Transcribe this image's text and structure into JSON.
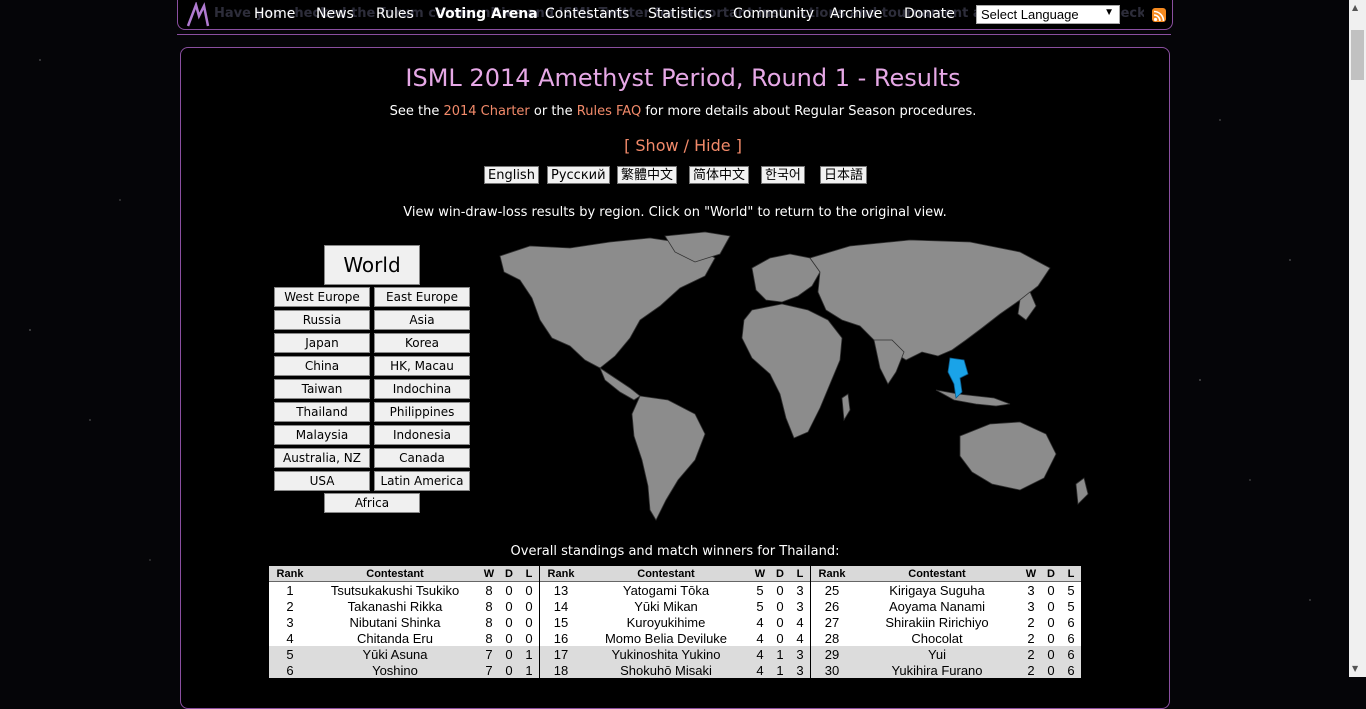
{
  "nav": {
    "ghost_text": "Have you checked the forum communities and ISML Twitter for important instructions and tournament announcements? Check out the upcoming events and other fun activities.",
    "items": [
      "Home",
      "News",
      "Rules",
      "Voting Arena",
      "Contestants",
      "Statistics",
      "Community",
      "Archive",
      "Donate"
    ],
    "language_select": "Select Language"
  },
  "page": {
    "title": "ISML 2014 Amethyst Period, Round 1 - Results",
    "subtitle_pre": "See the ",
    "subtitle_link1": "2014 Charter",
    "subtitle_mid": " or the ",
    "subtitle_link2": "Rules FAQ",
    "subtitle_post": " for more details about Regular Season procedures.",
    "show_hide": "[ Show / Hide ]",
    "languages": [
      "English",
      "Русский",
      "繁體中文",
      "简体中文",
      "한국어",
      "日本語"
    ],
    "instructions": "View win-draw-loss results by region. Click on \"World\" to return to the original view.",
    "standings_caption": "Overall standings and match winners for Thailand:"
  },
  "regions": {
    "world": "World",
    "buttons": [
      "West Europe",
      "East Europe",
      "Russia",
      "Asia",
      "Japan",
      "Korea",
      "China",
      "HK, Macau",
      "Taiwan",
      "Indochina",
      "Thailand",
      "Philippines",
      "Malaysia",
      "Indonesia",
      "Australia, NZ",
      "Canada",
      "USA",
      "Latin America",
      "Africa"
    ]
  },
  "table": {
    "headers": [
      "Rank",
      "Contestant",
      "W",
      "D",
      "L"
    ],
    "columns": [
      [
        [
          "1",
          "Tsutsukakushi Tsukiko",
          "8",
          "0",
          "0"
        ],
        [
          "2",
          "Takanashi Rikka",
          "8",
          "0",
          "0"
        ],
        [
          "3",
          "Nibutani Shinka",
          "8",
          "0",
          "0"
        ],
        [
          "4",
          "Chitanda Eru",
          "8",
          "0",
          "0"
        ],
        [
          "5",
          "Yūki Asuna",
          "7",
          "0",
          "1"
        ],
        [
          "6",
          "Yoshino",
          "7",
          "0",
          "1"
        ]
      ],
      [
        [
          "13",
          "Yatogami Tōka",
          "5",
          "0",
          "3"
        ],
        [
          "14",
          "Yūki Mikan",
          "5",
          "0",
          "3"
        ],
        [
          "15",
          "Kuroyukihime",
          "4",
          "0",
          "4"
        ],
        [
          "16",
          "Momo Belia Deviluke",
          "4",
          "0",
          "4"
        ],
        [
          "17",
          "Yukinoshita Yukino",
          "4",
          "1",
          "3"
        ],
        [
          "18",
          "Shokuhō Misaki",
          "4",
          "1",
          "3"
        ]
      ],
      [
        [
          "25",
          "Kirigaya Suguha",
          "3",
          "0",
          "5"
        ],
        [
          "26",
          "Aoyama Nanami",
          "3",
          "0",
          "5"
        ],
        [
          "27",
          "Shirakiin Ririchiyo",
          "2",
          "0",
          "6"
        ],
        [
          "28",
          "Chocolat",
          "2",
          "0",
          "6"
        ],
        [
          "29",
          "Yui",
          "2",
          "0",
          "6"
        ],
        [
          "30",
          "Yukihira Furano",
          "2",
          "0",
          "6"
        ]
      ]
    ]
  },
  "colors": {
    "accent": "#8a4fa0",
    "title": "#e6a8e6",
    "link": "#f28a6a",
    "highlight_region": "#1aa3e8",
    "land": "#8c8c8c"
  }
}
